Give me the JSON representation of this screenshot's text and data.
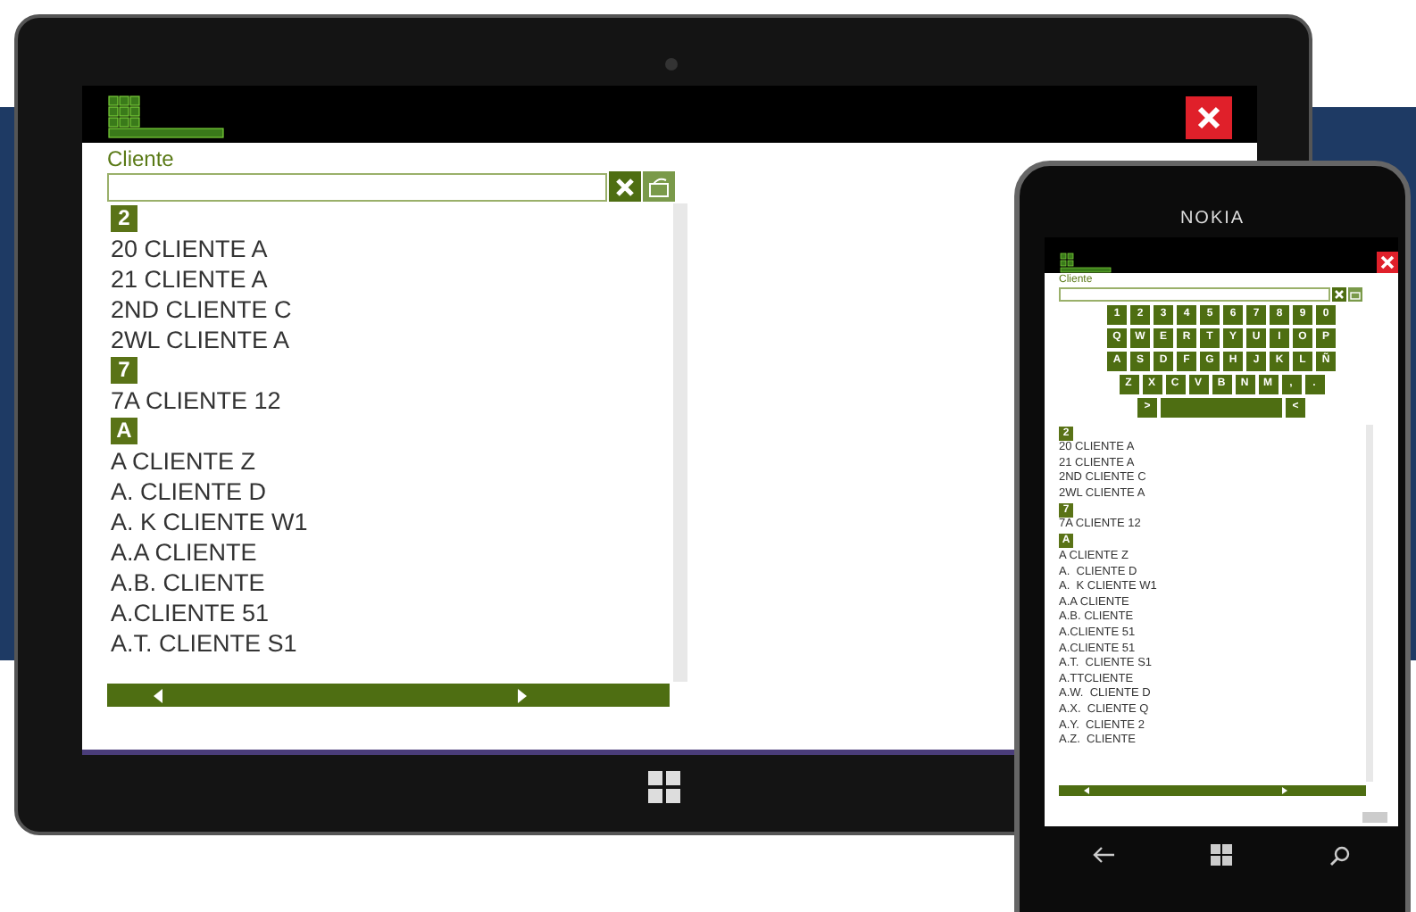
{
  "tablet": {
    "app": {
      "field_label": "Cliente",
      "groups": [
        {
          "header": "2",
          "items": [
            "20 CLIENTE A",
            "21 CLIENTE A",
            "2ND CLIENTE C",
            "2WL CLIENTE A"
          ]
        },
        {
          "header": "7",
          "items": [
            "7A CLIENTE 12"
          ]
        },
        {
          "header": "A",
          "items": [
            "A CLIENTE Z",
            "A. CLIENTE D",
            "A. K CLIENTE W1",
            "A.A CLIENTE",
            "A.B. CLIENTE",
            "A.CLIENTE 51",
            "A.T. CLIENTE S1"
          ]
        }
      ]
    }
  },
  "phone": {
    "brand": "NOKIA",
    "app": {
      "field_label": "Cliente",
      "keyboard": [
        [
          "1",
          "2",
          "3",
          "4",
          "5",
          "6",
          "7",
          "8",
          "9",
          "0"
        ],
        [
          "Q",
          "W",
          "E",
          "R",
          "T",
          "Y",
          "U",
          "I",
          "O",
          "P"
        ],
        [
          "A",
          "S",
          "D",
          "F",
          "G",
          "H",
          "J",
          "K",
          "L",
          "Ñ"
        ],
        [
          "Z",
          "X",
          "C",
          "V",
          "B",
          "N",
          "M",
          ",",
          "."
        ],
        [
          ">",
          "<"
        ]
      ],
      "groups": [
        {
          "header": "2",
          "items": [
            "20 CLIENTE A",
            "21 CLIENTE A",
            "2ND CLIENTE C",
            "2WL CLIENTE A"
          ]
        },
        {
          "header": "7",
          "items": [
            "7A CLIENTE 12"
          ]
        },
        {
          "header": "A",
          "items": [
            "A CLIENTE Z",
            "A.  CLIENTE D",
            "A.  K CLIENTE W1",
            "A.A CLIENTE",
            "A.B. CLIENTE",
            "A.CLIENTE 51",
            "A.CLIENTE 51",
            "A.T.  CLIENTE S1",
            "A.TTCLIENTE",
            "A.W.  CLIENTE D",
            "A.X.  CLIENTE Q",
            "A.Y.  CLIENTE 2",
            "A.Z.  CLIENTE"
          ]
        }
      ]
    }
  }
}
